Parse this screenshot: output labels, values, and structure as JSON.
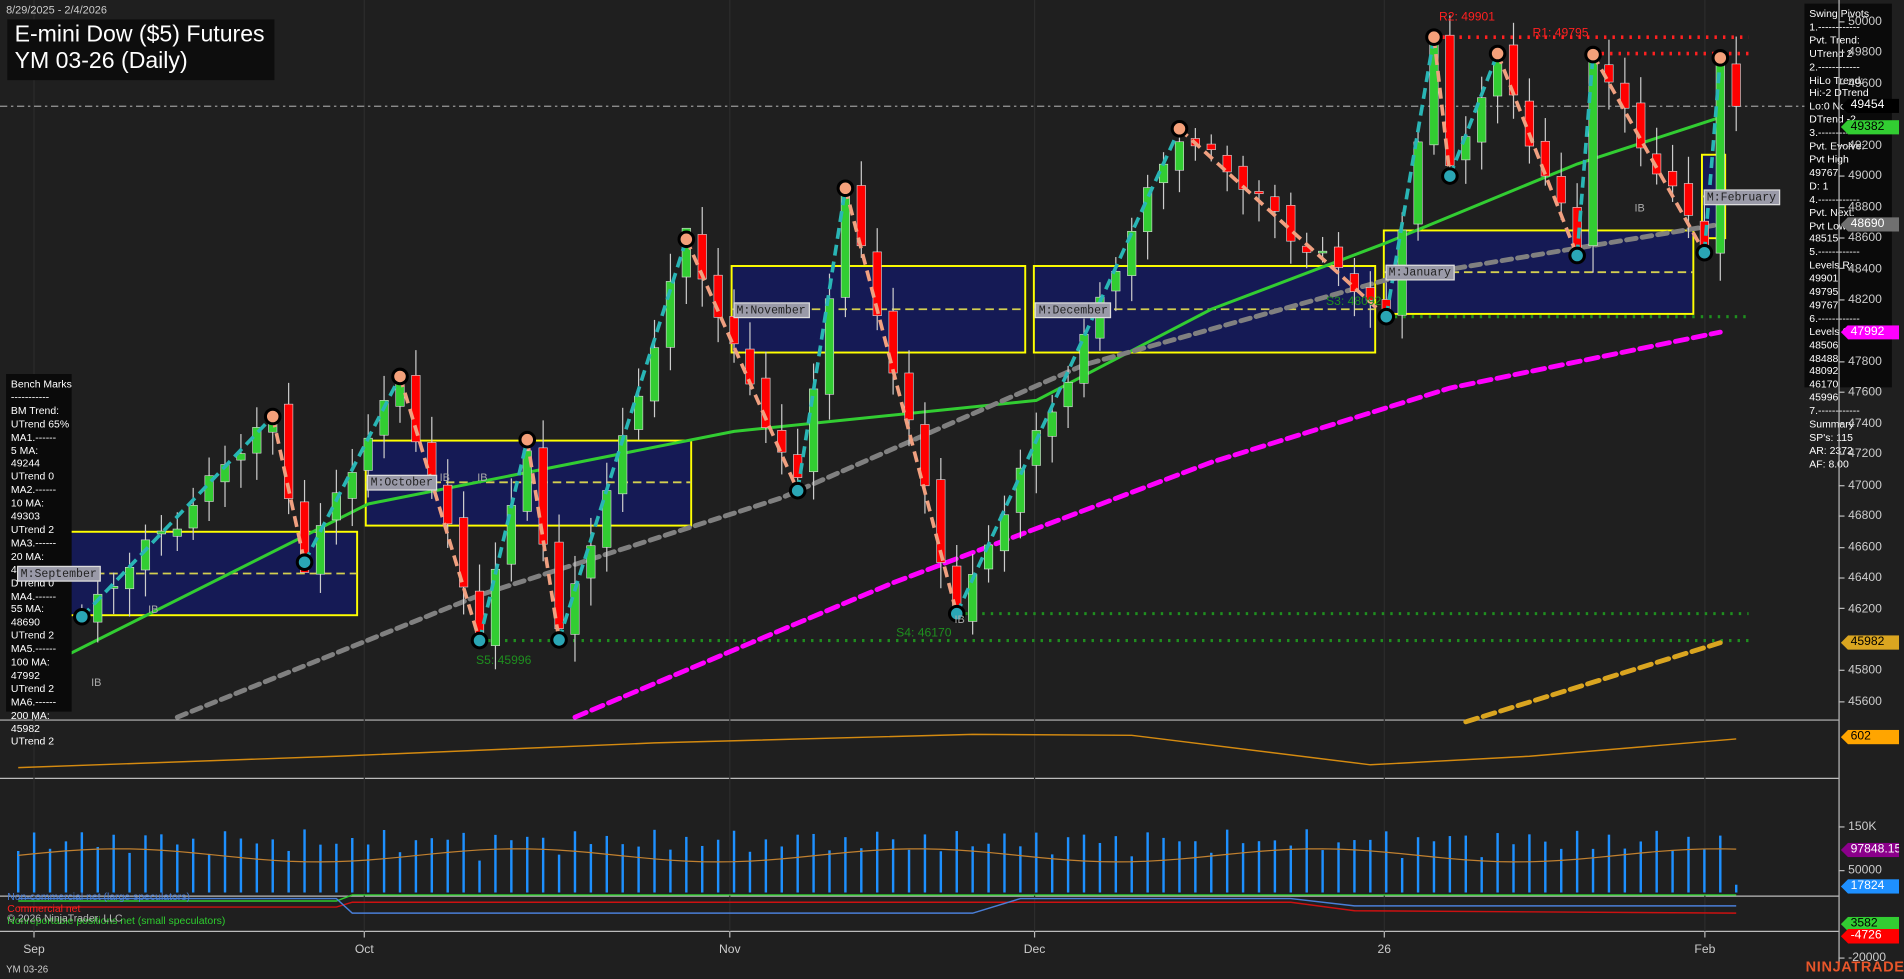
{
  "header": {
    "date_range": "8/29/2025 - 2/4/2026",
    "title_line1": "E-mini Dow ($5) Futures",
    "title_line2": "YM 03-26 (Daily)"
  },
  "instrument_footer": "YM 03-26",
  "copyright": "© 2026 NinjaTrader, LLC",
  "logo": "NINJATRADER",
  "colors": {
    "up": "#32cd32",
    "down": "#ff0000",
    "swing_up": "#29b5b5",
    "swing_down": "#f0a080",
    "ma20": "#32cd32",
    "ma55": "#808080",
    "ma100": "#ff00ff",
    "ma200": "#daa520",
    "value_area": "#151a55",
    "value_area_border": "#ffff00"
  },
  "bench_marks": [
    "Bench Marks",
    "-----------",
    "BM Trend:",
    "UTrend 65%",
    "MA1.------",
    "5 MA:",
    "49244",
    "UTrend 0",
    "MA2.------",
    "10 MA:",
    "49303",
    "UTrend 2",
    "MA3.------",
    "20 MA:",
    "49382",
    "DTrend 0",
    "MA4.------",
    "55 MA:",
    "48690",
    "UTrend 2",
    "MA5.------",
    "100 MA:",
    "47992",
    "UTrend 2",
    "MA6.------",
    "200 MA:",
    "45982",
    "UTrend 2"
  ],
  "swing_pivots": [
    "Swing Pivots",
    "1.------------",
    "Pvt. Trend:",
    "UTrend 2",
    "2.------------",
    "HiLo Trend:",
    "Hi:-2 DTrend",
    "Lo:0 Neutral",
    "DTrend -2",
    "3.------------",
    "Pvt. Evolve:",
    "Pvt High",
    "49767",
    "D: 1",
    "4.------------",
    "Pvt. Next:",
    "Pvt Low",
    "48515",
    "5.------------",
    "Levels R:",
    "49901",
    "49795",
    "49767",
    "6.------------",
    "Levels S:",
    "48506",
    "48488",
    "48092",
    "46170",
    "45996",
    "7.------------",
    "Summary",
    "SP's: 115",
    "AR: 2372",
    "AF: 8.00"
  ],
  "axis": {
    "price_ticks": [
      "50000",
      "49800",
      "49600",
      "49200",
      "49000",
      "48800",
      "48600",
      "48400",
      "48200",
      "47800",
      "47600",
      "47400",
      "47200",
      "47000",
      "46800",
      "46600",
      "46400",
      "46200",
      "45800",
      "45600"
    ],
    "volume_ticks": [
      "150K",
      "50000"
    ],
    "cot_ticks": [
      "-20000"
    ],
    "x_labels": [
      "Sep",
      "Oct",
      "Nov",
      "Dec",
      "26",
      "Feb"
    ]
  },
  "price_tags": [
    {
      "label": "49454",
      "price": 49454,
      "bg": "#000000",
      "fg": "#ffffff"
    },
    {
      "label": "49382",
      "price": 49382,
      "bg": "#32cd32",
      "fg": "#000000"
    },
    {
      "label": "48690",
      "price": 48690,
      "bg": "#707070",
      "fg": "#ffffff"
    },
    {
      "label": "47992",
      "price": 47992,
      "bg": "#ff00ff",
      "fg": "#ffffff"
    },
    {
      "label": "45982",
      "price": 45982,
      "bg": "#daa520",
      "fg": "#000000"
    }
  ],
  "indicator_tags": [
    {
      "label": "602",
      "bg": "#ffa500",
      "fg": "#000000"
    },
    {
      "label": "97848.15",
      "bg": "#8b008b",
      "fg": "#ffffff"
    },
    {
      "label": "17824",
      "bg": "#1e90ff",
      "fg": "#ffffff"
    },
    {
      "label": "3582",
      "bg": "#32cd32",
      "fg": "#000000"
    },
    {
      "label": "-4726",
      "bg": "#ff0000",
      "fg": "#ffffff"
    }
  ],
  "levels": [
    {
      "label": "R2: 49901",
      "price": 49901,
      "color": "#ff2020",
      "from": 89
    },
    {
      "label": "R1: 49795",
      "price": 49795,
      "color": "#ff2020",
      "from": 99
    },
    {
      "label": "S3: 48092",
      "price": 48092,
      "color": "#1f8f1f",
      "from": 86
    },
    {
      "label": "S4: 46170",
      "price": 46170,
      "color": "#1f8f1f",
      "from": 59
    },
    {
      "label": "S5: 45996",
      "price": 45996,
      "color": "#1f8f1f",
      "from": 29
    }
  ],
  "value_areas": [
    {
      "label": "M:September",
      "start": 0,
      "end": 21,
      "high": 46700,
      "low": 46160,
      "mid": 46430
    },
    {
      "label": "M:October",
      "start": 22,
      "end": 42,
      "high": 47290,
      "low": 46740,
      "mid": 47020
    },
    {
      "label": "M:November",
      "start": 45,
      "end": 63,
      "high": 48420,
      "low": 47860,
      "mid": 48140
    },
    {
      "label": "M:December",
      "start": 64,
      "end": 85,
      "high": 48420,
      "low": 47860,
      "mid": 48140
    },
    {
      "label": "M:January",
      "start": 86,
      "end": 105,
      "high": 48650,
      "low": 48110,
      "mid": 48380
    },
    {
      "label": "M:February",
      "start": 106,
      "end": 107,
      "high": 49140,
      "low": 48600,
      "mid": 48870
    }
  ],
  "cot_legend": [
    "Non-commercial net (large speculators)",
    "Commercial net",
    "Nonreportable positions net (small speculators)"
  ],
  "ib_marks": [
    "IB",
    "IB",
    "IB",
    "IB",
    "IB",
    "IB"
  ],
  "chart_data": {
    "type": "candlestick",
    "title": "E-mini Dow ($5) Futures YM 03-26 (Daily)",
    "bars": 109,
    "ylim": [
      45500,
      50100
    ],
    "last_price": 49454,
    "swing_pivots": [
      {
        "bar": 0,
        "price": 46300,
        "type": "start"
      },
      {
        "bar": 4,
        "price": 46150,
        "type": "low"
      },
      {
        "bar": 16,
        "price": 47446,
        "type": "high"
      },
      {
        "bar": 18,
        "price": 46503,
        "type": "low"
      },
      {
        "bar": 24,
        "price": 47705,
        "type": "high"
      },
      {
        "bar": 29,
        "price": 45996,
        "type": "low"
      },
      {
        "bar": 32,
        "price": 47296,
        "type": "high"
      },
      {
        "bar": 34,
        "price": 46000,
        "type": "low"
      },
      {
        "bar": 42,
        "price": 48593,
        "type": "high"
      },
      {
        "bar": 49,
        "price": 46966,
        "type": "low"
      },
      {
        "bar": 52,
        "price": 48923,
        "type": "high"
      },
      {
        "bar": 59,
        "price": 46170,
        "type": "low"
      },
      {
        "bar": 73,
        "price": 49308,
        "type": "high"
      },
      {
        "bar": 86,
        "price": 48092,
        "type": "low"
      },
      {
        "bar": 89,
        "price": 49901,
        "type": "high"
      },
      {
        "bar": 90,
        "price": 49002,
        "type": "low"
      },
      {
        "bar": 93,
        "price": 49795,
        "type": "high"
      },
      {
        "bar": 98,
        "price": 48488,
        "type": "low"
      },
      {
        "bar": 99,
        "price": 49788,
        "type": "high"
      },
      {
        "bar": 106,
        "price": 48506,
        "type": "low"
      },
      {
        "bar": 107,
        "price": 49767,
        "type": "high"
      },
      {
        "bar": 108,
        "price": 49454,
        "type": "end"
      }
    ],
    "moving_averages": [
      {
        "name": "20 MA",
        "color": "#32cd32",
        "dash": "",
        "points": [
          [
            3,
            45898
          ],
          [
            22,
            46880
          ],
          [
            45,
            47350
          ],
          [
            64,
            47550
          ],
          [
            75,
            48140
          ],
          [
            86,
            48570
          ],
          [
            98,
            49080
          ],
          [
            107,
            49382
          ]
        ]
      },
      {
        "name": "55 MA",
        "color": "#808080",
        "dash": "8 5",
        "points": [
          [
            10,
            45500
          ],
          [
            29,
            46290
          ],
          [
            48,
            46920
          ],
          [
            67,
            47780
          ],
          [
            86,
            48330
          ],
          [
            107,
            48690
          ]
        ]
      },
      {
        "name": "100 MA",
        "color": "#ff00ff",
        "dash": "10 5",
        "points": [
          [
            35,
            45500
          ],
          [
            55,
            46370
          ],
          [
            75,
            47150
          ],
          [
            90,
            47630
          ],
          [
            107,
            47992
          ]
        ]
      },
      {
        "name": "200 MA",
        "color": "#daa520",
        "dash": "10 5",
        "points": [
          [
            91,
            45470
          ],
          [
            107,
            45982
          ]
        ]
      }
    ],
    "atr": {
      "last": 602,
      "points": [
        [
          0,
          300
        ],
        [
          20,
          420
        ],
        [
          40,
          560
        ],
        [
          60,
          650
        ],
        [
          70,
          640
        ],
        [
          85,
          330
        ],
        [
          95,
          420
        ],
        [
          108,
          602
        ]
      ],
      "ylim": [
        200,
        800
      ]
    },
    "volume": {
      "last": 17824,
      "avg_last": 97848.15,
      "ylim": [
        0,
        200000
      ]
    },
    "cot": {
      "noncommercial_last": -4726,
      "commercial_last": -4726,
      "nonreportable_last": 3582
    }
  }
}
